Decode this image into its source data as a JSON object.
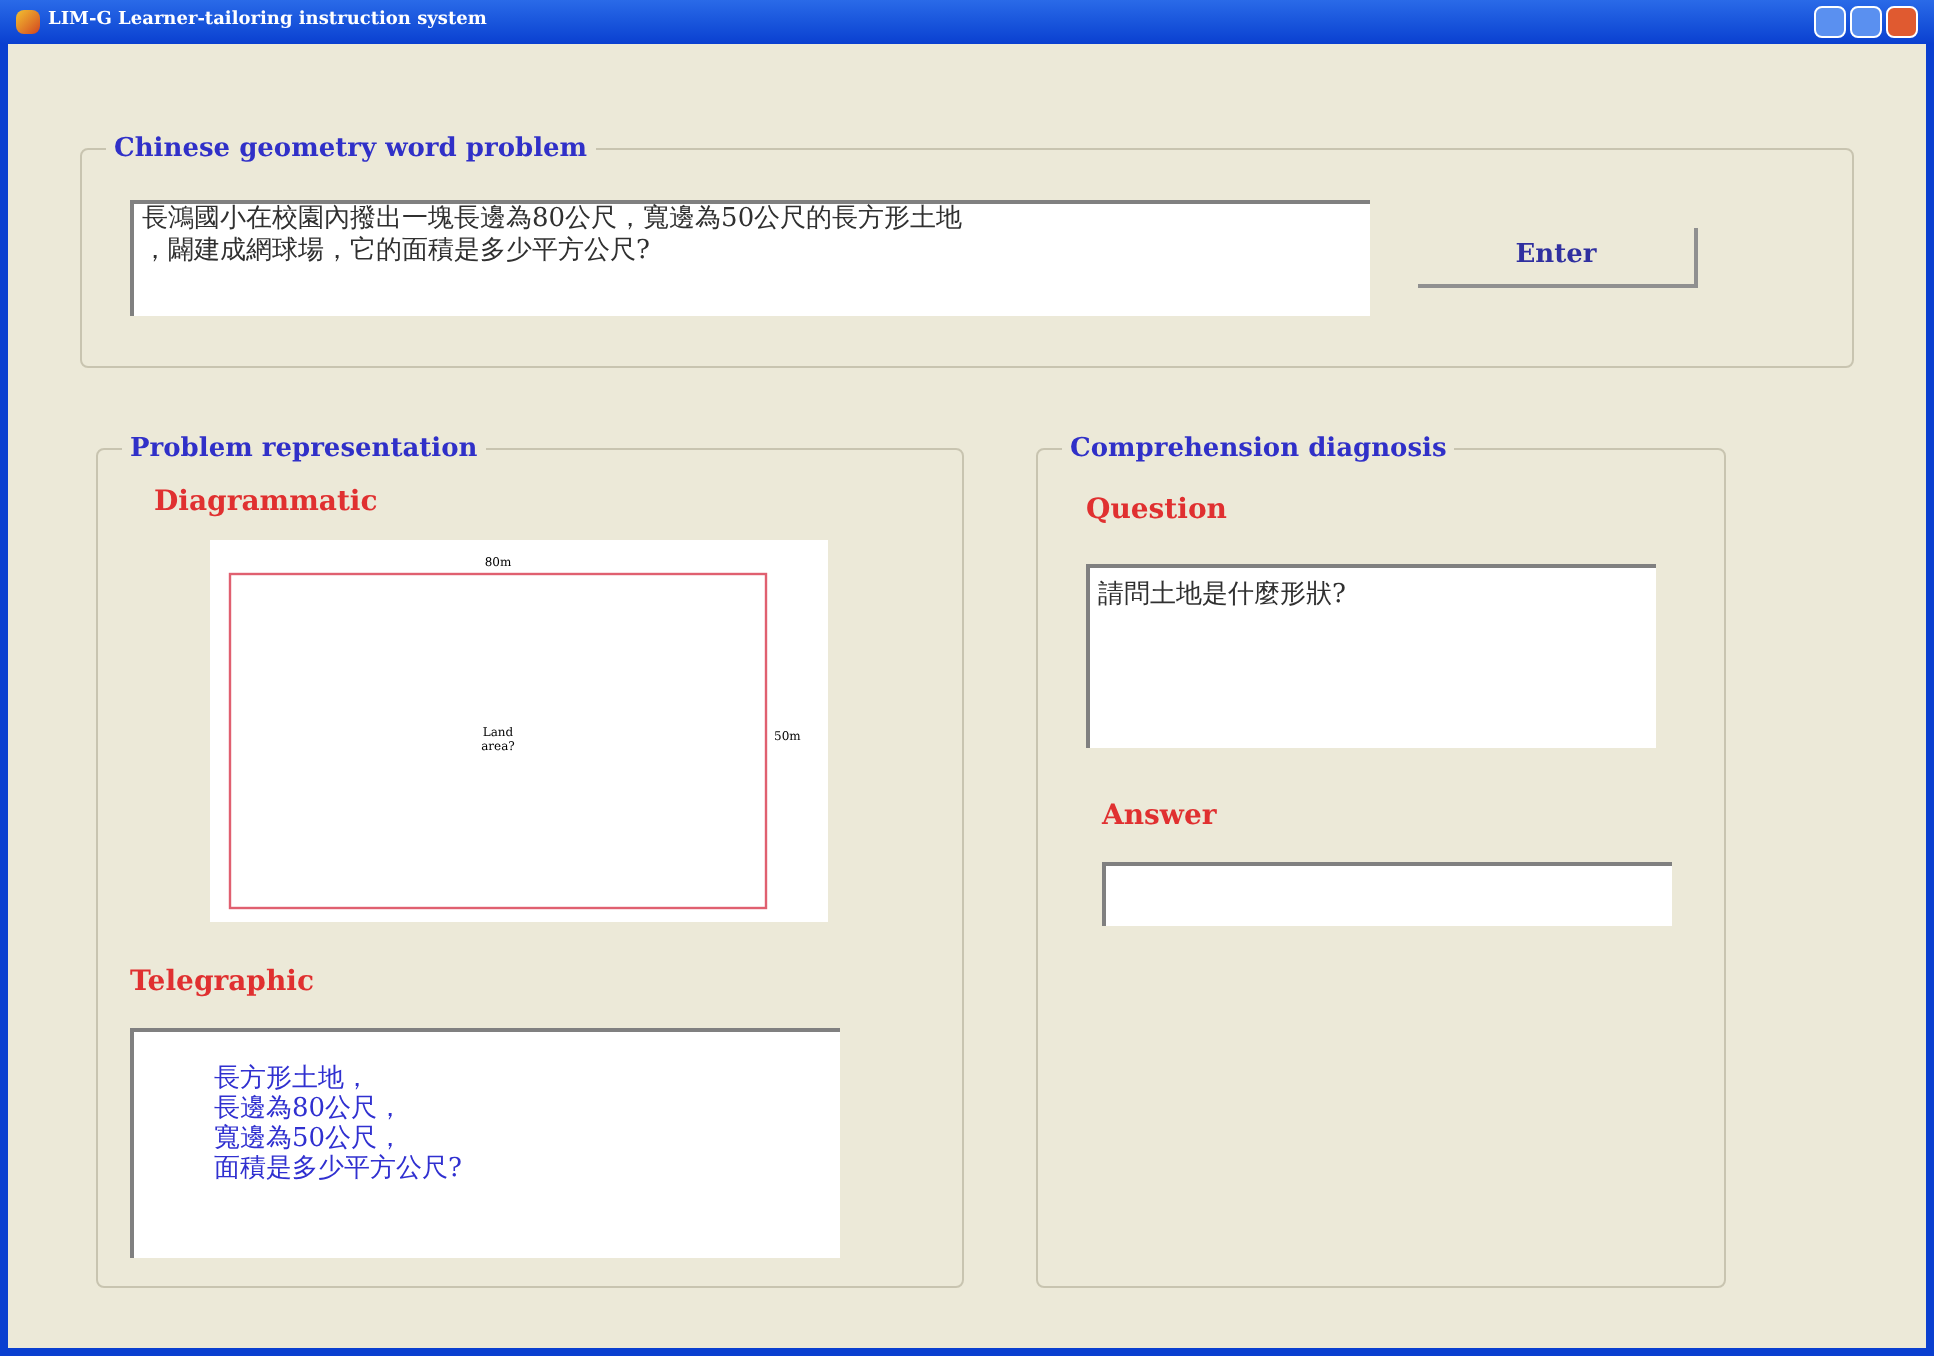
{
  "window": {
    "title": "LIM-G Learner-tailoring instruction system"
  },
  "word_problem": {
    "legend": "Chinese geometry word problem",
    "lines": [
      "長鴻國小在校園內撥出一塊長邊為80公尺，寬邊為50公尺的長方形土地",
      "，闢建成網球場，它的面積是多少平方公尺?"
    ],
    "button": "Enter"
  },
  "representation": {
    "legend": "Problem representation",
    "diagram_label": "Diagrammatic",
    "diagram": {
      "top": "80m",
      "side": "50m",
      "center": [
        "Land",
        "area?"
      ]
    },
    "telegraphic_label": "Telegraphic",
    "telegraphic": [
      "長方形土地，",
      "長邊為80公尺，",
      "寬邊為50公尺，",
      "面積是多少平方公尺?"
    ]
  },
  "diagnosis": {
    "legend": "Comprehension diagnosis",
    "question_label": "Question",
    "question": "請問土地是什麼形狀?",
    "answer_label": "Answer"
  }
}
